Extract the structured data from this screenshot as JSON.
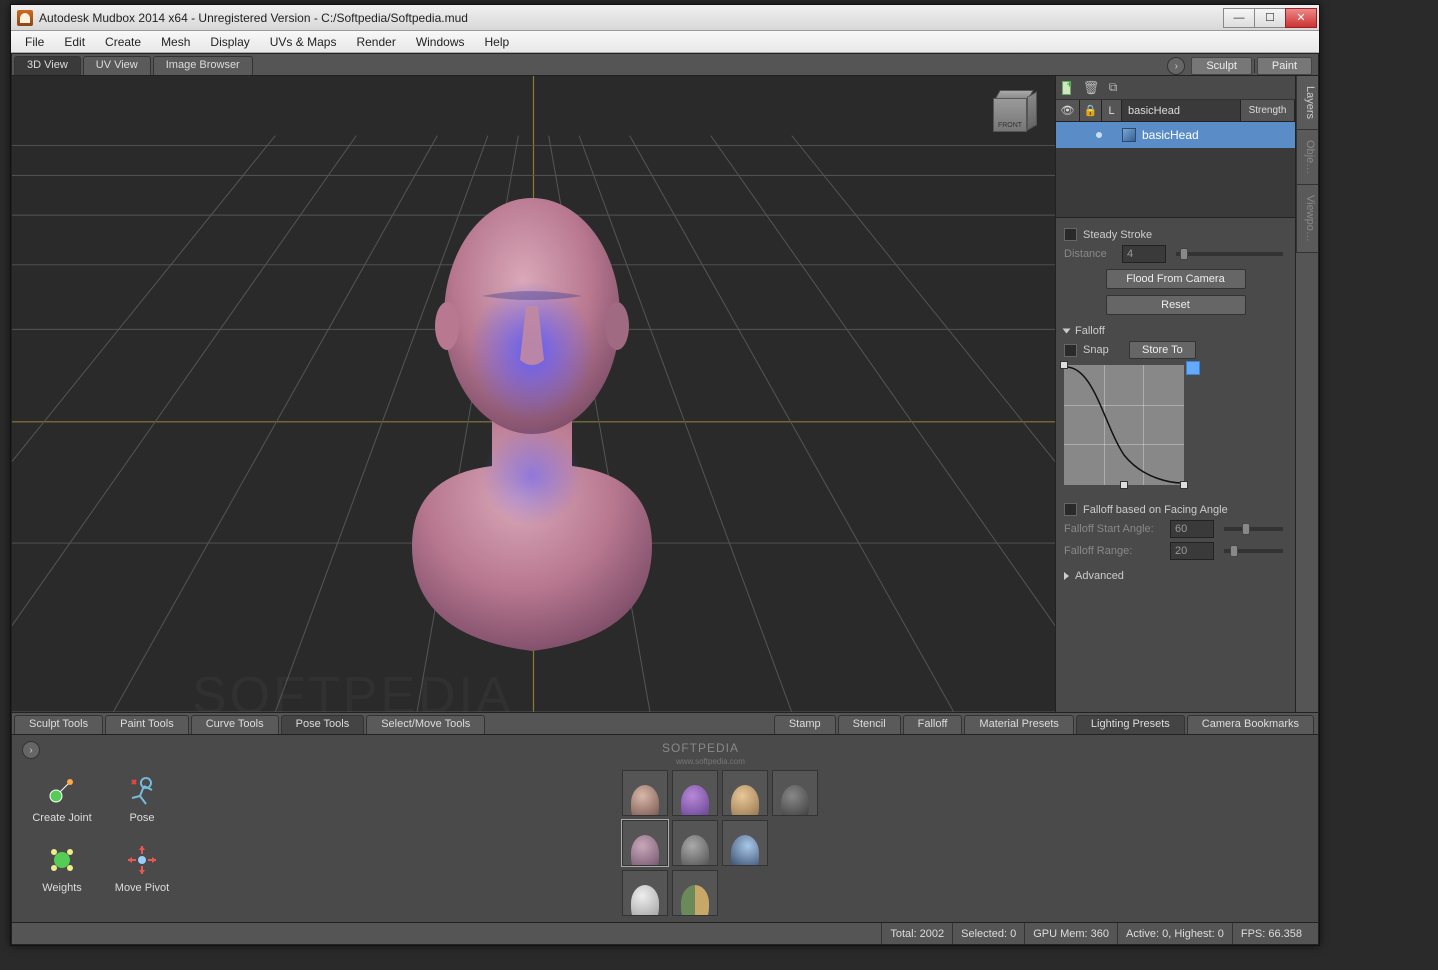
{
  "titlebar": {
    "title": "Autodesk Mudbox 2014 x64 - Unregistered Version - C:/Softpedia/Softpedia.mud"
  },
  "menubar": [
    "File",
    "Edit",
    "Create",
    "Mesh",
    "Display",
    "UVs & Maps",
    "Render",
    "Windows",
    "Help"
  ],
  "view_tabs": [
    {
      "label": "3D View",
      "active": true
    },
    {
      "label": "UV View",
      "active": false
    },
    {
      "label": "Image Browser",
      "active": false
    }
  ],
  "mode_buttons": [
    "Sculpt",
    "Paint"
  ],
  "right_tabs": [
    "Layers",
    "Obje…",
    "Viewpo…"
  ],
  "layer_panel": {
    "columns": {
      "eye": "👁",
      "lock": "🔒",
      "l": "L",
      "name": "basicHead",
      "strength": "Strength"
    },
    "item": {
      "name": "basicHead"
    }
  },
  "props": {
    "steady_stroke": "Steady Stroke",
    "distance_label": "Distance",
    "distance_value": "4",
    "flood": "Flood From Camera",
    "reset": "Reset",
    "falloff": "Falloff",
    "snap": "Snap",
    "store": "Store To",
    "facing": "Falloff based on Facing Angle",
    "start_label": "Falloff Start Angle:",
    "start_value": "60",
    "range_label": "Falloff Range:",
    "range_value": "20",
    "advanced": "Advanced"
  },
  "bottom_tabs_left": [
    {
      "label": "Sculpt Tools",
      "active": false
    },
    {
      "label": "Paint Tools",
      "active": false
    },
    {
      "label": "Curve Tools",
      "active": false
    },
    {
      "label": "Pose Tools",
      "active": true
    },
    {
      "label": "Select/Move Tools",
      "active": false
    }
  ],
  "bottom_tabs_right": [
    {
      "label": "Stamp",
      "active": false
    },
    {
      "label": "Stencil",
      "active": false
    },
    {
      "label": "Falloff",
      "active": false
    },
    {
      "label": "Material Presets",
      "active": false
    },
    {
      "label": "Lighting Presets",
      "active": true
    },
    {
      "label": "Camera Bookmarks",
      "active": false
    }
  ],
  "pose_tools": [
    {
      "name": "Create Joint"
    },
    {
      "name": "Pose"
    },
    {
      "name": "Weights"
    },
    {
      "name": "Move Pivot"
    }
  ],
  "preset_watermark": "SOFTPEDIA",
  "preset_sub": "www.softpedia.com",
  "viewcube_face": "FRONT",
  "vp_watermark": "SOFTPEDIA",
  "bg_watermark": "SOFTPEDIA",
  "status": {
    "total": "Total: 2002",
    "selected": "Selected: 0",
    "gpu": "GPU Mem: 360",
    "active": "Active: 0, Highest: 0",
    "fps": "FPS: 66.358"
  }
}
